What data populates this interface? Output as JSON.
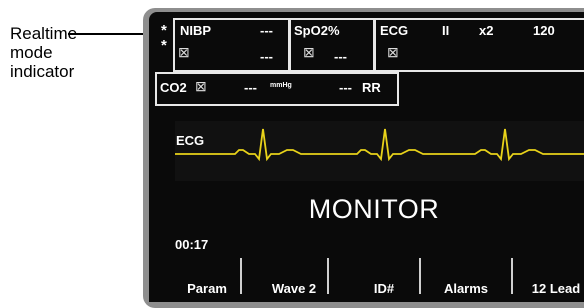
{
  "callout": {
    "label_line1": "Realtime",
    "label_line2": "mode",
    "label_line3": "indicator"
  },
  "indicator": {
    "stars": "*\n*"
  },
  "vitals": {
    "nibp": {
      "label": "NIBP",
      "value": "---",
      "sub_value": "---"
    },
    "spo2": {
      "label": "SpO2%",
      "value": "---"
    },
    "ecg": {
      "label": "ECG",
      "lead": "II",
      "gain": "x2",
      "hr": "120"
    },
    "co2": {
      "label": "CO2",
      "value": "---",
      "unit": "mmHg",
      "rr_value": "---",
      "rr_label": "RR"
    }
  },
  "waveform": {
    "label": "ECG",
    "color": "#e8d21a"
  },
  "mode": {
    "title": "MONITOR"
  },
  "status": {
    "elapsed_time": "00:17"
  },
  "softkeys": [
    "Param",
    "Wave 2",
    "ID#",
    "Alarms",
    "12 Lead"
  ],
  "icons": {
    "alarm_off": "alarm-off-icon"
  }
}
